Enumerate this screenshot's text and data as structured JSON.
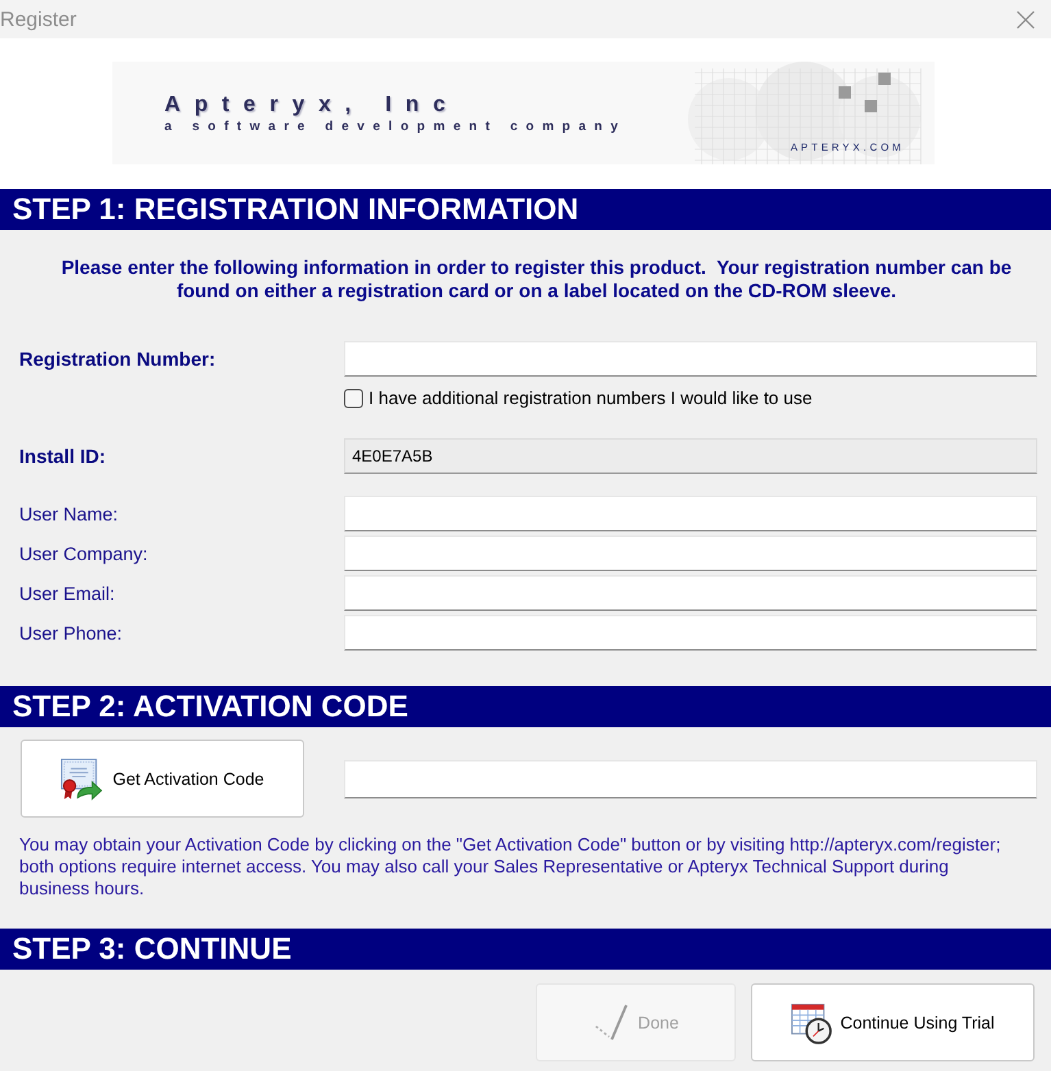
{
  "window": {
    "title": "Register"
  },
  "banner": {
    "company": "Apteryx, Inc",
    "tagline": "a software development company",
    "website": "APTERYX.COM"
  },
  "steps": [
    {
      "kind": "registration",
      "heading": "STEP 1: REGISTRATION INFORMATION",
      "instructions": "Please enter the following information in order to register this product.  Your registration number can be found on either a registration card or on a label located on the CD-ROM sleeve.",
      "rows": [
        {
          "kind": "field",
          "label": "Registration Number:",
          "emphasized": true,
          "readonly": false
        },
        {
          "kind": "checkbox",
          "label": "I have additional registration numbers I would like to use",
          "checked": false
        },
        {
          "kind": "field",
          "label": "Install ID:",
          "emphasized": true,
          "readonly": true,
          "value": "4E0E7A5B"
        },
        {
          "kind": "field",
          "label": "User Name:",
          "emphasized": false,
          "readonly": false
        },
        {
          "kind": "field",
          "label": "User Company:",
          "emphasized": false,
          "readonly": false
        },
        {
          "kind": "field",
          "label": "User Email:",
          "emphasized": false,
          "readonly": false
        },
        {
          "kind": "field",
          "label": "User Phone:",
          "emphasized": false,
          "readonly": false
        }
      ]
    },
    {
      "kind": "activation",
      "heading": "STEP 2: ACTIVATION CODE",
      "button": {
        "label": "Get Activation Code"
      },
      "note": "You may obtain your Activation Code by clicking on the \"Get Activation Code\" button or by visiting http://apteryx.com/register; both options require internet access. You may also call your Sales Representative or Apteryx Technical Support during business hours."
    },
    {
      "kind": "continue",
      "heading": "STEP 3: CONTINUE",
      "buttons": [
        {
          "kind": "done",
          "label": "Done",
          "disabled": true
        },
        {
          "kind": "trial",
          "label": "Continue Using Trial",
          "disabled": false
        }
      ]
    }
  ]
}
